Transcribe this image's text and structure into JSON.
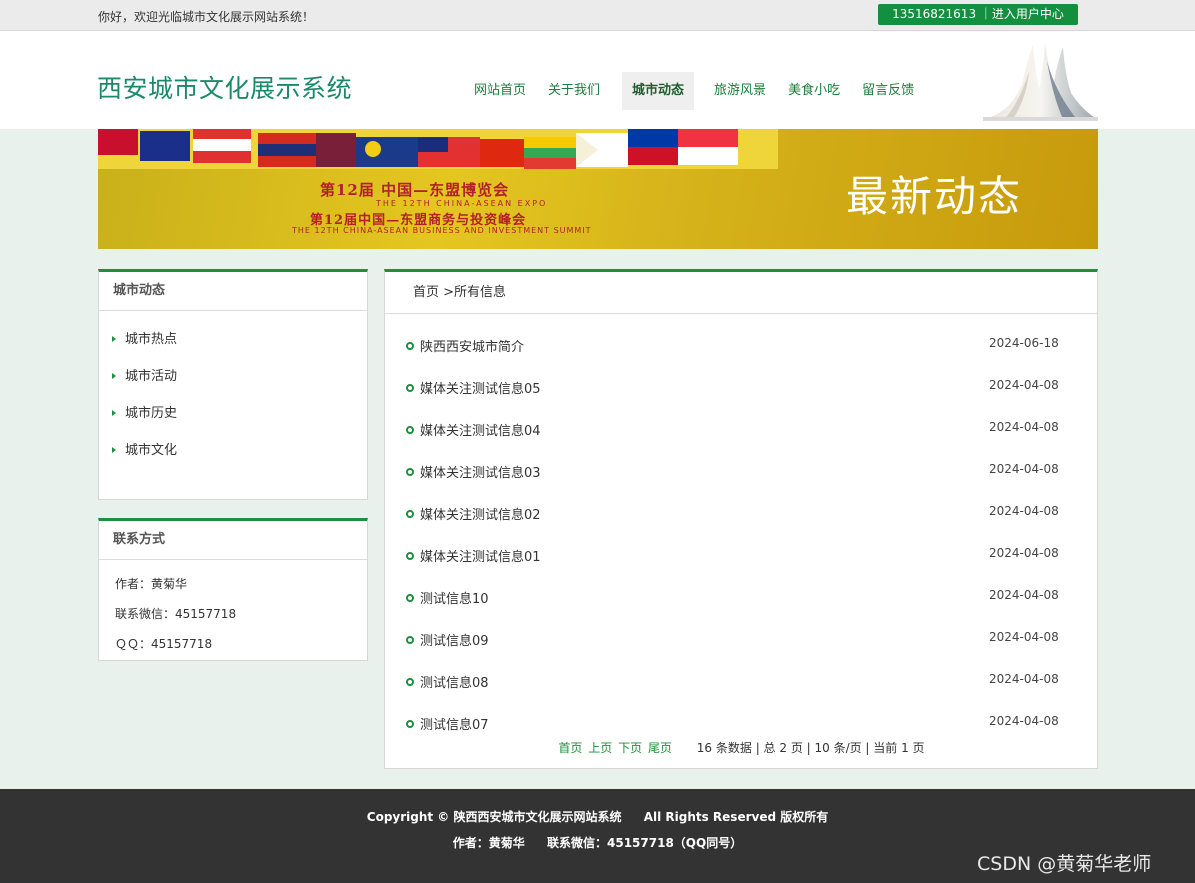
{
  "topbar": {
    "welcome": "你好，欢迎光临城市文化展示网站系统！",
    "user_center": "13516821613 ｜进入用户中心"
  },
  "header": {
    "site_title": "西安城市文化展示系统",
    "nav": [
      {
        "label": "网站首页"
      },
      {
        "label": "关于我们"
      },
      {
        "label": "城市动态"
      },
      {
        "label": "旅游风景"
      },
      {
        "label": "美食小吃"
      },
      {
        "label": "留言反馈"
      }
    ],
    "active_nav": "城市动态"
  },
  "banner": {
    "expo_line1": "第12届 中国—东盟博览会",
    "expo_line1_sub": "THE 12TH CHINA-ASEAN EXPO",
    "expo_line2": "第12届中国—东盟商务与投资峰会",
    "expo_line2_sub": "THE 12TH CHINA-ASEAN BUSINESS AND INVESTMENT SUMMIT",
    "heading": "最新动态"
  },
  "sidebar": {
    "category_title": "城市动态",
    "categories": [
      {
        "label": "城市热点"
      },
      {
        "label": "城市活动"
      },
      {
        "label": "城市历史"
      },
      {
        "label": "城市文化"
      }
    ],
    "contact_title": "联系方式",
    "contact": {
      "author": "作者：黄菊华",
      "wechat": "联系微信：45157718",
      "qq": "ＱＱ：45157718"
    }
  },
  "main": {
    "breadcrumb": "首页 >所有信息",
    "news": [
      {
        "title": "陕西西安城市简介",
        "date": "2024-06-18"
      },
      {
        "title": "媒体关注测试信息05",
        "date": "2024-04-08"
      },
      {
        "title": "媒体关注测试信息04",
        "date": "2024-04-08"
      },
      {
        "title": "媒体关注测试信息03",
        "date": "2024-04-08"
      },
      {
        "title": "媒体关注测试信息02",
        "date": "2024-04-08"
      },
      {
        "title": "媒体关注测试信息01",
        "date": "2024-04-08"
      },
      {
        "title": "测试信息10",
        "date": "2024-04-08"
      },
      {
        "title": "测试信息09",
        "date": "2024-04-08"
      },
      {
        "title": "测试信息08",
        "date": "2024-04-08"
      },
      {
        "title": "测试信息07",
        "date": "2024-04-08"
      }
    ],
    "pager": {
      "first": "首页",
      "prev": "上页",
      "next": "下页",
      "last": "尾页",
      "info": "16 条数据 | 总 2 页 | 10 条/页 | 当前 1 页"
    }
  },
  "footer": {
    "copyright": "Copyright © 陕西西安城市文化展示网站系统",
    "rights": "All Rights Reserved 版权所有",
    "author": "作者：黄菊华",
    "wechat": "联系微信：45157718（QQ同号）"
  },
  "watermark": "CSDN @黄菊华老师",
  "colors": {
    "accent": "#1e8f3e",
    "title": "#1c8a6a",
    "footer_bg": "#333333",
    "page_bg": "#e8f1ec"
  }
}
